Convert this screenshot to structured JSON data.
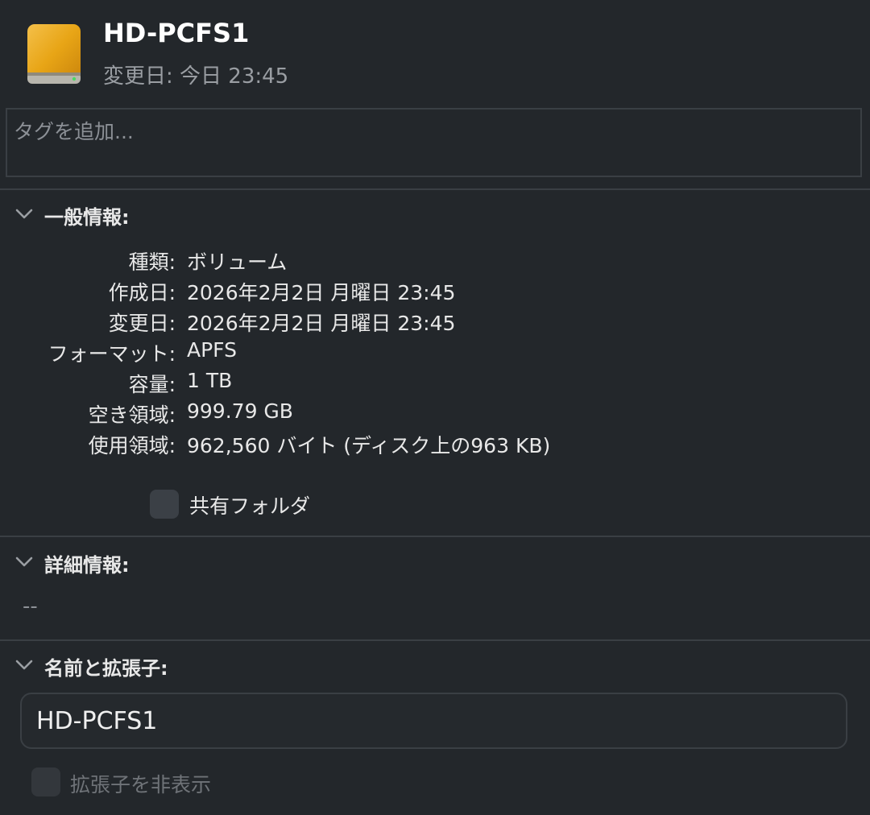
{
  "header": {
    "title": "HD-PCFS1",
    "modified": "変更日: 今日 23:45",
    "icon": "external-drive-icon",
    "icon_color": "#e8a516"
  },
  "tags": {
    "placeholder": "タグを追加..."
  },
  "general": {
    "title": "一般情報:",
    "rows": [
      {
        "label": "種類:",
        "value": "ボリューム"
      },
      {
        "label": "作成日:",
        "value": "2026年2月2日 月曜日 23:45"
      },
      {
        "label": "変更日:",
        "value": "2026年2月2日 月曜日 23:45"
      },
      {
        "label": "フォーマット:",
        "value": "APFS"
      },
      {
        "label": "容量:",
        "value": "1 TB"
      },
      {
        "label": "空き領域:",
        "value": "999.79 GB"
      },
      {
        "label": "使用領域:",
        "value": "962,560 バイト (ディスク上の963 KB)"
      }
    ],
    "shared_folder_label": "共有フォルダ",
    "shared_folder_checked": false
  },
  "more_info": {
    "title": "詳細情報:",
    "value": "--"
  },
  "name_ext": {
    "title": "名前と拡張子:",
    "name_value": "HD-PCFS1",
    "hide_extension_label": "拡張子を非表示",
    "hide_extension_checked": false
  }
}
